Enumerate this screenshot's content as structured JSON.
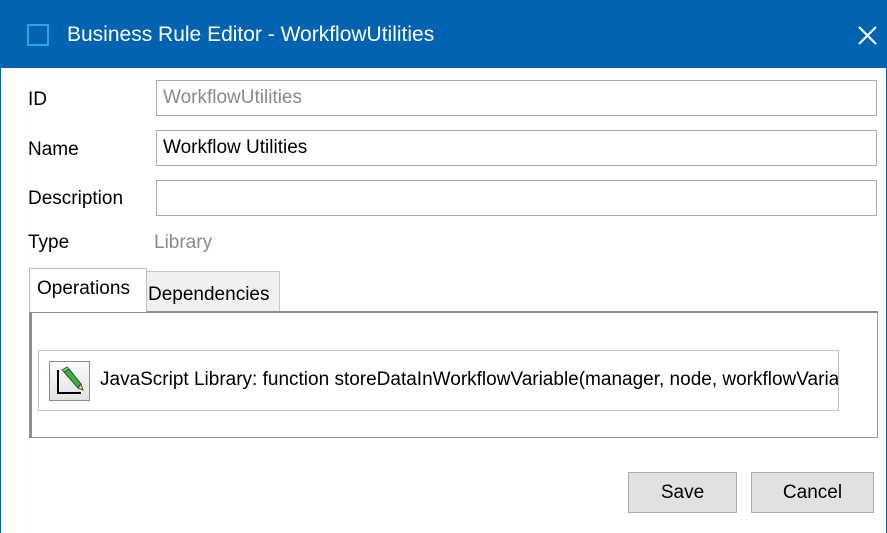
{
  "window": {
    "title": "Business Rule Editor - WorkflowUtilities",
    "title_bar_color": "#0063b1"
  },
  "form": {
    "id_label": "ID",
    "id_value": "WorkflowUtilities",
    "name_label": "Name",
    "name_value": "Workflow Utilities",
    "description_label": "Description",
    "description_value": "",
    "type_label": "Type",
    "type_value": "Library"
  },
  "tabs": [
    {
      "label": "Operations",
      "selected": true
    },
    {
      "label": "Dependencies",
      "selected": false
    }
  ],
  "operations": [
    {
      "icon": "edit-pencil-icon",
      "text": "JavaScript Library: function storeDataInWorkflowVariable(manager, node, workflowVariable, data) {"
    }
  ],
  "buttons": {
    "save": "Save",
    "cancel": "Cancel"
  }
}
